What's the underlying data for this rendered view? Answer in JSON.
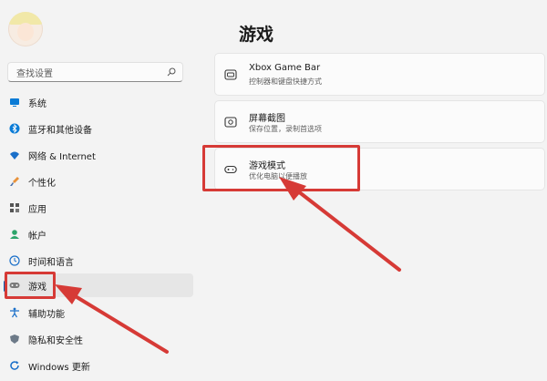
{
  "sidebar": {
    "avatar_icon": "user-avatar-icon",
    "search": {
      "placeholder": "查找设置",
      "icon": "search-icon"
    },
    "items": [
      {
        "label": "系统",
        "icon": "monitor-icon"
      },
      {
        "label": "蓝牙和其他设备",
        "icon": "bluetooth-icon"
      },
      {
        "label": "网络 & Internet",
        "icon": "wifi-icon"
      },
      {
        "label": "个性化",
        "icon": "brush-icon"
      },
      {
        "label": "应用",
        "icon": "apps-icon"
      },
      {
        "label": "帐户",
        "icon": "account-icon"
      },
      {
        "label": "时间和语言",
        "icon": "globe-clock-icon"
      },
      {
        "label": "游戏",
        "icon": "gamepad-icon",
        "selected": true
      },
      {
        "label": "辅助功能",
        "icon": "accessibility-icon"
      },
      {
        "label": "隐私和安全性",
        "icon": "shield-icon"
      },
      {
        "label": "Windows 更新",
        "icon": "update-icon"
      }
    ]
  },
  "main": {
    "title": "游戏",
    "cards": [
      {
        "title": "Xbox Game Bar",
        "subtitle": "控制器和键盘快捷方式",
        "icon": "xbox-game-bar-icon"
      },
      {
        "title": "屏幕截图",
        "subtitle": "保存位置，录制首选项",
        "icon": "capture-icon"
      },
      {
        "title": "游戏模式",
        "subtitle": "优化电脑以便播放",
        "icon": "gamepad-icon"
      }
    ]
  },
  "annotations": {
    "highlight_color": "#d63a36",
    "accent_color": "#005fb8"
  }
}
